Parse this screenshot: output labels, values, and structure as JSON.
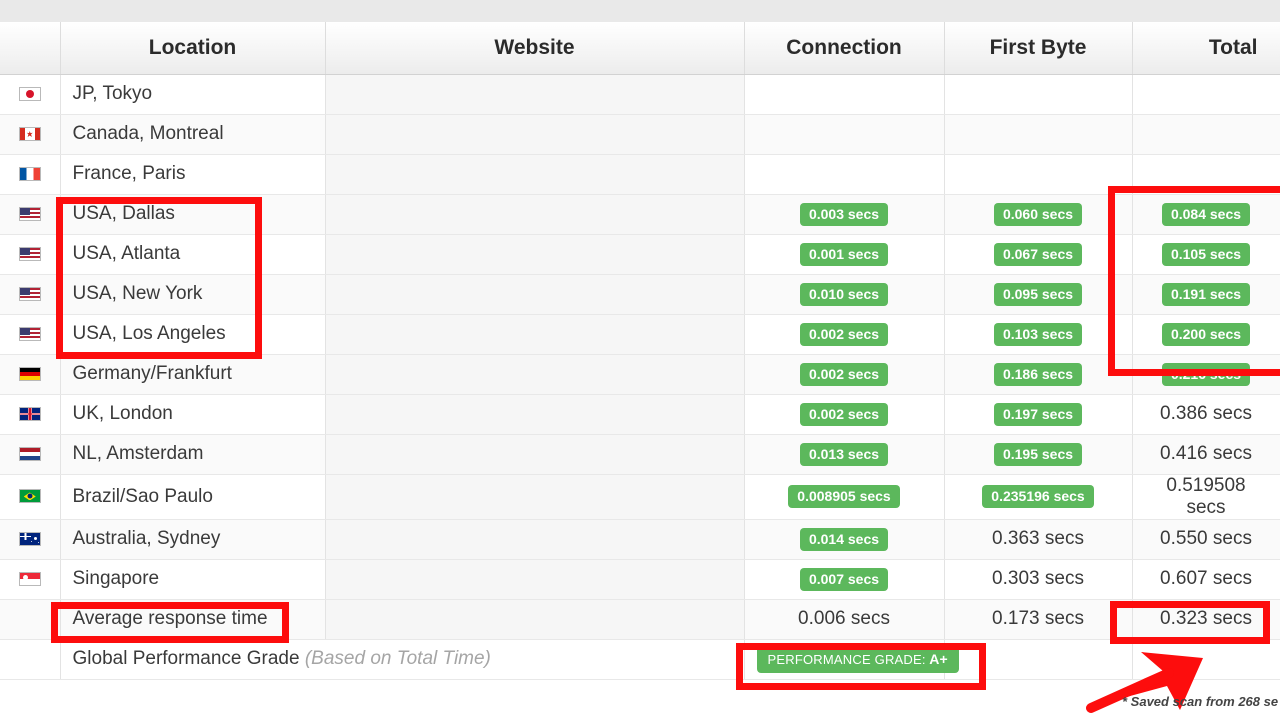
{
  "table": {
    "columns": [
      "",
      "Location",
      "Website",
      "Connection",
      "First Byte",
      "Total"
    ],
    "rows": [
      {
        "flag": "jp",
        "flag_name": "flag-japan-icon",
        "location": "JP, Tokyo",
        "connection": "",
        "first_byte": "",
        "total": "",
        "conn_badge": false,
        "fb_badge": false,
        "total_badge": false
      },
      {
        "flag": "ca",
        "flag_name": "flag-canada-icon",
        "location": "Canada, Montreal",
        "connection": "",
        "first_byte": "",
        "total": "",
        "conn_badge": false,
        "fb_badge": false,
        "total_badge": false
      },
      {
        "flag": "fr",
        "flag_name": "flag-france-icon",
        "location": "France, Paris",
        "connection": "",
        "first_byte": "",
        "total": "",
        "conn_badge": false,
        "fb_badge": false,
        "total_badge": false
      },
      {
        "flag": "us",
        "flag_name": "flag-usa-icon",
        "location": "USA, Dallas",
        "connection": "0.003 secs",
        "first_byte": "0.060 secs",
        "total": "0.084 secs",
        "conn_badge": true,
        "fb_badge": true,
        "total_badge": true
      },
      {
        "flag": "us",
        "flag_name": "flag-usa-icon",
        "location": "USA, Atlanta",
        "connection": "0.001 secs",
        "first_byte": "0.067 secs",
        "total": "0.105 secs",
        "conn_badge": true,
        "fb_badge": true,
        "total_badge": true
      },
      {
        "flag": "us",
        "flag_name": "flag-usa-icon",
        "location": "USA, New York",
        "connection": "0.010 secs",
        "first_byte": "0.095 secs",
        "total": "0.191 secs",
        "conn_badge": true,
        "fb_badge": true,
        "total_badge": true
      },
      {
        "flag": "us",
        "flag_name": "flag-usa-icon",
        "location": "USA, Los Angeles",
        "connection": "0.002 secs",
        "first_byte": "0.103 secs",
        "total": "0.200 secs",
        "conn_badge": true,
        "fb_badge": true,
        "total_badge": true
      },
      {
        "flag": "de",
        "flag_name": "flag-germany-icon",
        "location": "Germany/Frankfurt",
        "connection": "0.002 secs",
        "first_byte": "0.186 secs",
        "total": "0.216 secs",
        "conn_badge": true,
        "fb_badge": true,
        "total_badge": true
      },
      {
        "flag": "uk",
        "flag_name": "flag-uk-icon",
        "location": "UK, London",
        "connection": "0.002 secs",
        "first_byte": "0.197 secs",
        "total": "0.386 secs",
        "conn_badge": true,
        "fb_badge": true,
        "total_badge": false
      },
      {
        "flag": "nl",
        "flag_name": "flag-netherlands-icon",
        "location": "NL, Amsterdam",
        "connection": "0.013 secs",
        "first_byte": "0.195 secs",
        "total": "0.416 secs",
        "conn_badge": true,
        "fb_badge": true,
        "total_badge": false
      },
      {
        "flag": "br",
        "flag_name": "flag-brazil-icon",
        "location": "Brazil/Sao Paulo",
        "connection": "0.008905 secs",
        "first_byte": "0.235196 secs",
        "total": "0.519508 secs",
        "conn_badge": true,
        "fb_badge": true,
        "total_badge": false
      },
      {
        "flag": "au",
        "flag_name": "flag-australia-icon",
        "location": "Australia, Sydney",
        "connection": "0.014 secs",
        "first_byte": "0.363 secs",
        "total": "0.550 secs",
        "conn_badge": true,
        "fb_badge": false,
        "total_badge": false
      },
      {
        "flag": "sg",
        "flag_name": "flag-singapore-icon",
        "location": "Singapore",
        "connection": "0.007 secs",
        "first_byte": "0.303 secs",
        "total": "0.607 secs",
        "conn_badge": true,
        "fb_badge": false,
        "total_badge": false
      },
      {
        "flag": "",
        "flag_name": "",
        "location": "Average response time",
        "connection": "0.006 secs",
        "first_byte": "0.173 secs",
        "total": "0.323 secs",
        "conn_badge": false,
        "fb_badge": false,
        "total_badge": false
      }
    ]
  },
  "grade_row": {
    "label": "Global Performance Grade",
    "sub_label": "(Based on Total Time)",
    "badge_prefix": "PERFORMANCE GRADE:",
    "badge_value": "A+"
  },
  "footnote": "* Saved scan from 268 se",
  "colors": {
    "badge_green": "#5cb85c",
    "annotation_red": "#fd0d0d",
    "header_text": "#2b2b2b"
  }
}
